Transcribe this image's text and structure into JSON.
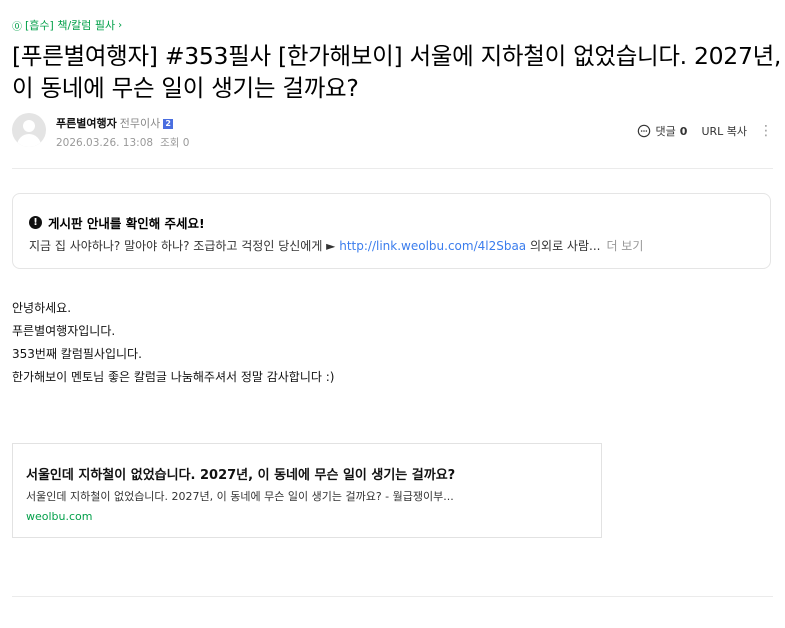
{
  "breadcrumb": {
    "badge": "⓪",
    "label": "[흡수] 책/칼럼 필사",
    "chevron": "›"
  },
  "post": {
    "title": "[푸른별여행자] #353필사 [한가해보이] 서울에 지하철이 없었습니다. 2027년, 이 동네에 무슨 일이 생기는 걸까요?",
    "author": {
      "name": "푸른별여행자",
      "role": "전무이사",
      "level": "2",
      "date": "2026.03.26. 13:08",
      "views": "조회 0"
    },
    "actions": {
      "comment_label": "댓글",
      "comment_count": "0",
      "url_copy": "URL 복사",
      "more": "⋮"
    }
  },
  "notice": {
    "title": "게시판 안내를 확인해 주세요!",
    "text_before": "지금 집 사야하나? 말아야 하나? 조급하고 걱정인 당신에게 ► ",
    "link": "http://link.weolbu.com/4l2Sbaa",
    "text_after": " 의외로 사람...",
    "more": "더 보기"
  },
  "content": {
    "lines": [
      "안녕하세요.",
      "푸른별여행자입니다.",
      "353번째 칼럼필사입니다.",
      "한가해보이 멘토님 좋은 칼럼글 나눔해주셔서 정말 감사합니다 :)"
    ]
  },
  "link_card": {
    "title": "서울인데 지하철이 없었습니다. 2027년, 이 동네에 무슨 일이 생기는 걸까요?",
    "description": "서울인데 지하철이 없었습니다. 2027년, 이 동네에 무슨 일이 생기는 걸까요? - 월급쟁이부...",
    "domain": "weolbu.com"
  },
  "colors": {
    "accent_green": "#03a04a",
    "link_blue": "#3b7ded",
    "level_blue": "#4a6ee0"
  }
}
